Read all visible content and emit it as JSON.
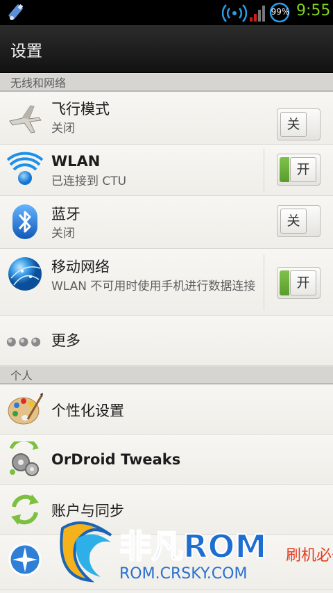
{
  "status_bar": {
    "battery": "99%",
    "time": "9:55",
    "icons": [
      "usb-icon",
      "wifi-icon",
      "signal-icon",
      "battery-icon"
    ]
  },
  "action_bar": {
    "title": "设置"
  },
  "sections": {
    "wireless": {
      "header": "无线和网络",
      "airplane": {
        "title": "飞行模式",
        "subtitle": "关闭",
        "toggle": "关"
      },
      "wlan": {
        "title": "WLAN",
        "subtitle": "已连接到 CTU",
        "toggle": "开"
      },
      "bluetooth": {
        "title": "蓝牙",
        "subtitle": "关闭",
        "toggle": "关"
      },
      "mobile": {
        "title": "移动网络",
        "subtitle": "WLAN 不可用时使用手机进行数据连接",
        "toggle": "开"
      },
      "more": {
        "title": "更多"
      }
    },
    "personal": {
      "header": "个人",
      "personalize": {
        "title": "个性化设置"
      },
      "tweaks": {
        "title": "OrDroid Tweaks"
      },
      "accounts": {
        "title": "账户与同步"
      }
    }
  },
  "watermark": {
    "brand": "非凡ROM",
    "url": "ROM.CRSKY.COM",
    "suffix": "刷机必备"
  },
  "colors": {
    "accent_green": "#7fd21c",
    "toggle_on": "#6cb23a",
    "wifi_blue": "#1e90e8"
  }
}
